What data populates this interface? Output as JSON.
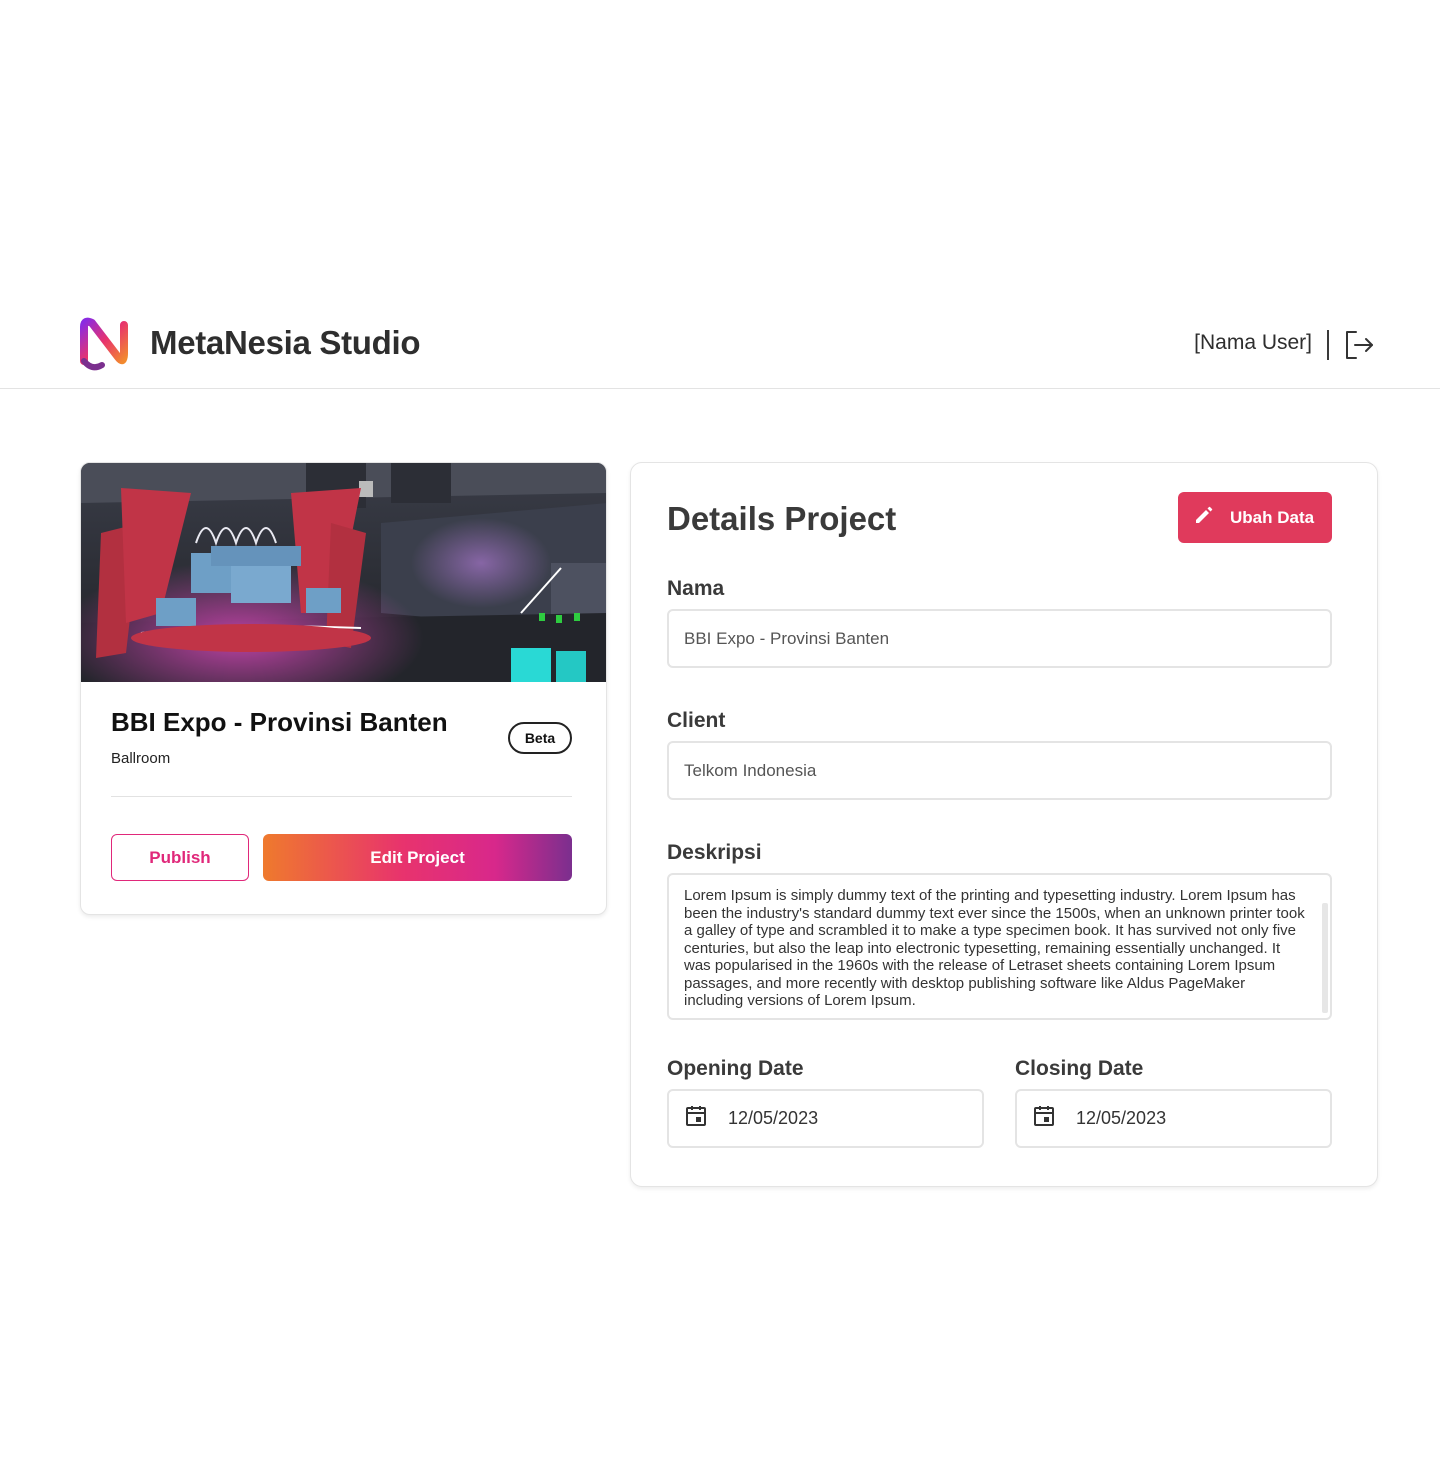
{
  "header": {
    "brand": "MetaNesia Studio",
    "user_name": "[Nama User]"
  },
  "card": {
    "title": "BBI Expo - Provinsi Banten",
    "subtitle": "Ballroom",
    "badge": "Beta",
    "publish_label": "Publish",
    "edit_label": "Edit Project"
  },
  "details": {
    "title": "Details Project",
    "edit_button": "Ubah Data",
    "nama_label": "Nama",
    "nama_value": "BBI Expo - Provinsi Banten",
    "client_label": "Client",
    "client_value": "Telkom Indonesia",
    "deskripsi_label": "Deskripsi",
    "deskripsi_value": "Lorem Ipsum is simply dummy text of the printing and typesetting industry. Lorem Ipsum has been the industry's standard dummy text ever since the 1500s, when an unknown printer took a galley of type and scrambled it to make a type specimen book. It has survived not only five centuries, but also the leap into electronic typesetting, remaining essentially unchanged. It was popularised in the 1960s with the release of Letraset sheets containing Lorem Ipsum passages, and more recently with desktop publishing software like Aldus PageMaker including versions of Lorem Ipsum.",
    "opening_label": "Opening Date",
    "opening_value": "12/05/2023",
    "closing_label": "Closing Date",
    "closing_value": "12/05/2023"
  },
  "colors": {
    "accent_pink": "#e0287a",
    "ubah_button": "#e03a5c",
    "gradient_start": "#ef7a2d",
    "gradient_end": "#7b2f8e"
  },
  "icons": {
    "logo": "metanesia-logo",
    "logout": "logout-icon",
    "edit": "pencil-icon",
    "calendar": "calendar-icon"
  }
}
